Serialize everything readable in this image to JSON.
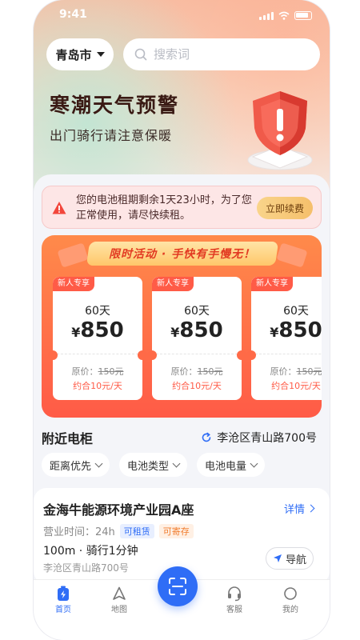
{
  "status_bar": {
    "time": "9:41"
  },
  "header": {
    "city": "青岛市",
    "search_placeholder": "搜索词"
  },
  "hero": {
    "title": "寒潮天气预警",
    "subtitle": "出门骑行请注意保暖"
  },
  "alert": {
    "message": "您的电池租期剩余1天23小时，为了您正常使用，请尽快续租。",
    "button": "立即续费"
  },
  "promo": {
    "banner": "限时活动 · 手快有手慢无！",
    "cards": [
      {
        "tag": "新人专享",
        "duration": "60天",
        "currency": "¥",
        "price": "850",
        "original_label": "原价：",
        "original_price": "150元",
        "daily": "约合10元/天"
      },
      {
        "tag": "新人专享",
        "duration": "60天",
        "currency": "¥",
        "price": "850",
        "original_label": "原价：",
        "original_price": "150元",
        "daily": "约合10元/天"
      },
      {
        "tag": "新人专享",
        "duration": "60天",
        "currency": "¥",
        "price": "850",
        "original_label": "原价：",
        "original_price": "150元",
        "daily": "约合10元/天"
      }
    ]
  },
  "nearby": {
    "title": "附近电柜",
    "location": "李沧区青山路700号",
    "filters": [
      "距离优先",
      "电池类型",
      "电池电量"
    ]
  },
  "station": {
    "name": "金海牛能源环境产业园A座",
    "detail": "详情",
    "hours": "营业时间：24h",
    "badge_rent": "可租赁",
    "badge_store": "可寄存",
    "distance": "100m · 骑行1分钟",
    "address": "李沧区青山路700号",
    "nav": "导航"
  },
  "tabbar": {
    "items": [
      {
        "label": "首页"
      },
      {
        "label": "地图"
      },
      {
        "label": "客服"
      },
      {
        "label": "我的"
      }
    ]
  },
  "colors": {
    "accent": "#2f6df6",
    "promo": "#ff5b47"
  }
}
